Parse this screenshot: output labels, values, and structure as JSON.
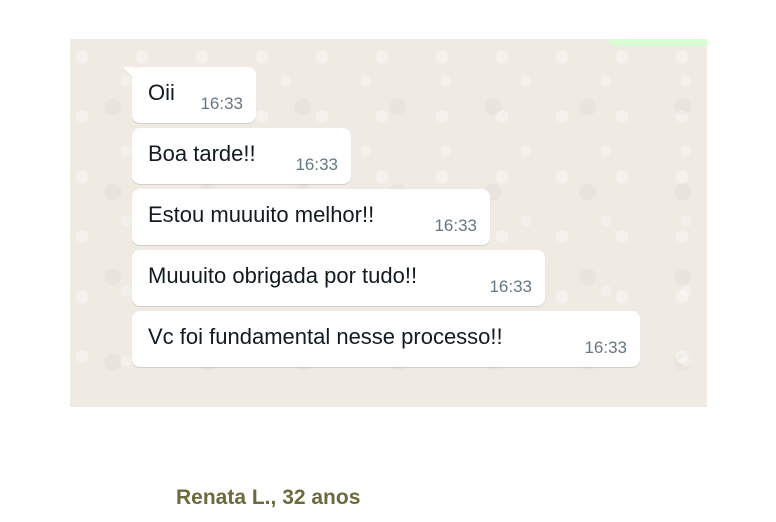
{
  "messages": [
    {
      "text": "Oii",
      "time": "16:33"
    },
    {
      "text": "Boa tarde!!",
      "time": "16:33"
    },
    {
      "text": "Estou muuuito melhor!!",
      "time": "16:33"
    },
    {
      "text": "Muuuito obrigada por tudo!!",
      "time": "16:33"
    },
    {
      "text": "Vc foi fundamental nesse processo!!",
      "time": "16:33"
    }
  ],
  "caption": "Renata L., 32 anos",
  "colors": {
    "chat_background": "#efeae2",
    "incoming_bubble": "#ffffff",
    "outgoing_bubble": "#d9fdd3",
    "timestamp": "#667781",
    "caption": "#6b6b3e"
  }
}
